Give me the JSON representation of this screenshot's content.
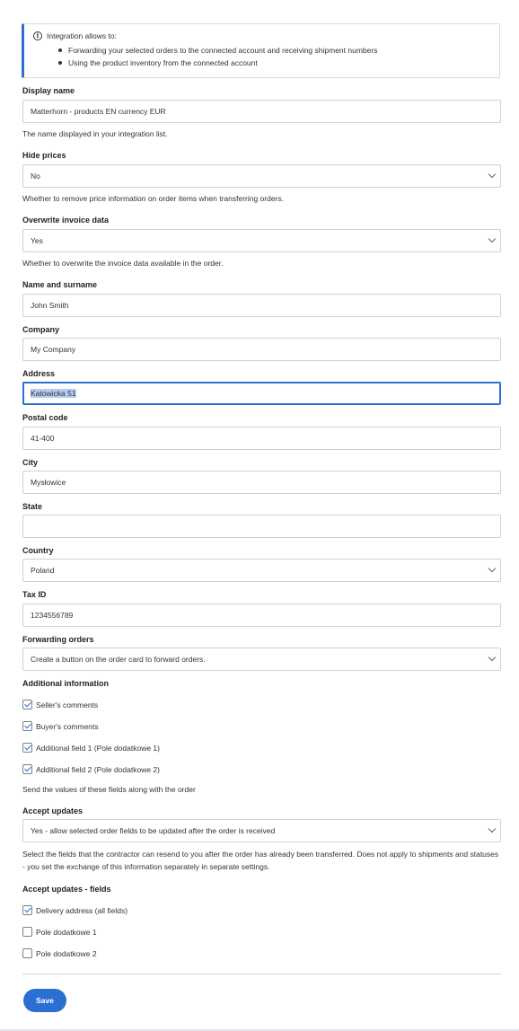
{
  "info": {
    "heading": "Integration allows to:",
    "items": [
      "Forwarding your selected orders to the connected account and receiving shipment numbers",
      "Using the product inventory from the connected account"
    ]
  },
  "display_name": {
    "label": "Display name",
    "value": "Matterhorn - products EN currency EUR",
    "help": "The name displayed in your integration list."
  },
  "hide_prices": {
    "label": "Hide prices",
    "value": "No",
    "help": "Whether to remove price information on order items when transferring orders."
  },
  "overwrite_invoice": {
    "label": "Overwrite invoice data",
    "value": "Yes",
    "help": "Whether to overwrite the invoice data available in the order."
  },
  "name_surname": {
    "label": "Name and surname",
    "value": "John Smith"
  },
  "company": {
    "label": "Company",
    "value": "My Company"
  },
  "address": {
    "label": "Address",
    "value": "Katowicka 51"
  },
  "postal_code": {
    "label": "Postal code",
    "value": "41-400"
  },
  "city": {
    "label": "City",
    "value": "Mysłowice"
  },
  "state": {
    "label": "State",
    "value": ""
  },
  "country": {
    "label": "Country",
    "value": "Poland"
  },
  "tax_id": {
    "label": "Tax ID",
    "value": "1234556789"
  },
  "forwarding_orders": {
    "label": "Forwarding orders",
    "value": "Create a button on the order card to forward orders."
  },
  "additional_info": {
    "label": "Additional information",
    "items": [
      {
        "label": "Seller's comments",
        "checked": true
      },
      {
        "label": "Buyer's comments",
        "checked": true
      },
      {
        "label": "Additional field 1 (Pole dodatkowe 1)",
        "checked": true
      },
      {
        "label": "Additional field 2 (Pole dodatkowe 2)",
        "checked": true
      }
    ],
    "help": "Send the values of these fields along with the order"
  },
  "accept_updates": {
    "label": "Accept updates",
    "value": "Yes - allow selected order fields to be updated after the order is received",
    "help": "Select the fields that the contractor can resend to you after the order has already been transferred. Does not apply to shipments and statuses - you set the exchange of this information separately in separate settings."
  },
  "accept_updates_fields": {
    "label": "Accept updates - fields",
    "items": [
      {
        "label": "Delivery address (all fields)",
        "checked": true
      },
      {
        "label": "Pole dodatkowe 1",
        "checked": false
      },
      {
        "label": "Pole dodatkowe 2",
        "checked": false
      }
    ]
  },
  "save_label": "Save",
  "colors": {
    "accent": "#2c6fd3",
    "border": "#ccd1d7",
    "selection": "#b3cdf2"
  },
  "icons": {
    "info": "info-circle-icon",
    "chevron": "chevron-down-icon",
    "check": "check-icon"
  }
}
